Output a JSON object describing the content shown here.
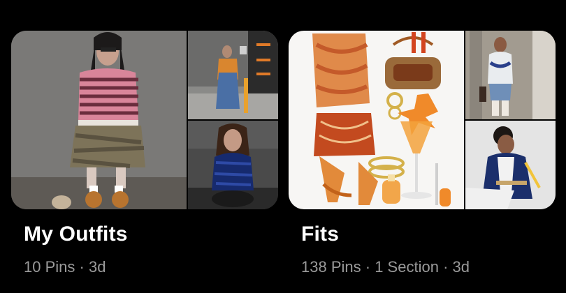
{
  "boards": [
    {
      "name": "My Outfits",
      "pins": "10 Pins",
      "sep": "·",
      "updated": "3d",
      "images": [
        "main-outfit-photo",
        "top-street-photo",
        "bottom-sitting-photo"
      ]
    },
    {
      "name": "Fits",
      "pins": "138 Pins",
      "sep": "·",
      "sections": "1 Section",
      "sep2": "·",
      "updated": "3d",
      "images": [
        "main-flatlay-collage",
        "top-mirror-selfie",
        "bottom-tracksuit-photo"
      ]
    }
  ],
  "colors": {
    "background": "#000000",
    "title": "#ffffff",
    "meta": "#9a9a9a"
  }
}
